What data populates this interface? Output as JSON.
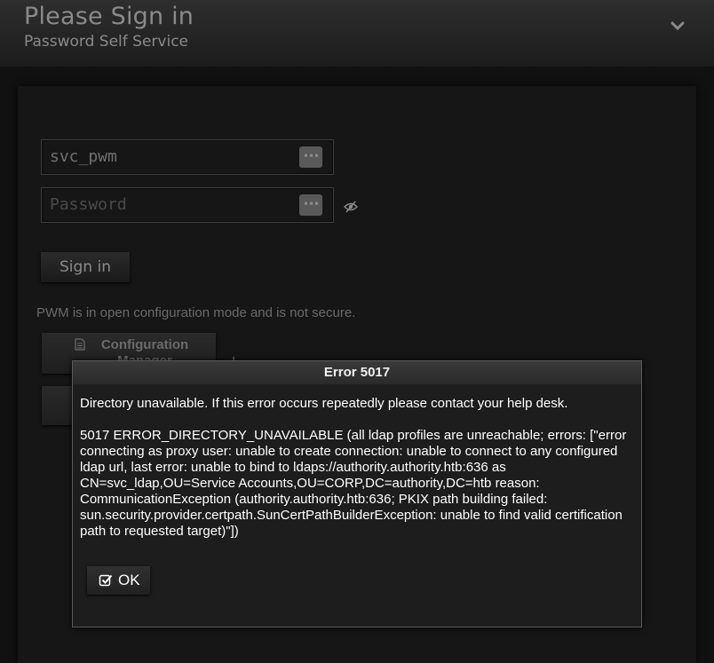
{
  "header": {
    "title": "Please Sign in",
    "subtitle": "Password Self Service",
    "menu_icon": "chevron-down-icon"
  },
  "login_form": {
    "username_value": "svc_pwm",
    "password_placeholder": "Password",
    "field_action_icon": "ellipsis-icon",
    "show_password_icon": "eye-slash-icon",
    "sign_in_label": "Sign in"
  },
  "warning": {
    "text": "PWM is in open configuration mode and is not secure."
  },
  "config_manager": {
    "label": "Configuration Manager",
    "icon": "document-icon"
  },
  "error_dialog": {
    "title": "Error 5017",
    "message": "Directory unavailable. If this error occurs repeatedly please contact your help desk.",
    "detail": "5017 ERROR_DIRECTORY_UNAVAILABLE (all ldap profiles are unreachable; errors: [\"error connecting as proxy user: unable to create connection: unable to connect to any configured ldap url, last error: unable to bind to ldaps://authority.authority.htb:636 as CN=svc_ldap,OU=Service Accounts,OU=CORP,DC=authority,DC=htb reason: CommunicationException (authority.authority.htb:636; PKIX path building failed: sun.security.provider.certpath.SunCertPathBuilderException: unable to find valid certification path to requested target)\"])",
    "ok_label": "OK",
    "ok_icon": "check-square-icon"
  },
  "colors": {
    "background": "#111111",
    "dialog_text": "#ffffff",
    "muted_text": "#8a8a8a"
  }
}
